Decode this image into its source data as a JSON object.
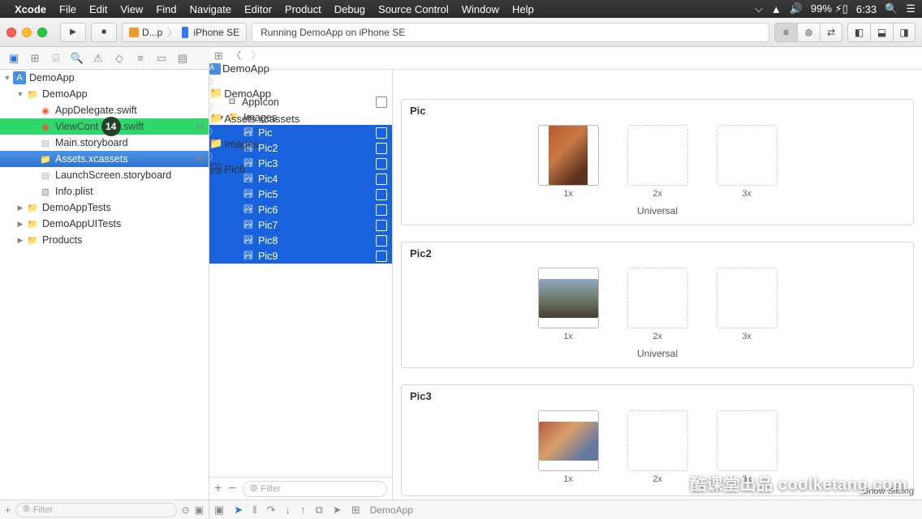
{
  "menubar": {
    "app": "Xcode",
    "items": [
      "File",
      "Edit",
      "View",
      "Find",
      "Navigate",
      "Editor",
      "Product",
      "Debug",
      "Source Control",
      "Window",
      "Help"
    ],
    "battery": "99%",
    "time": "6:33"
  },
  "toolbar": {
    "scheme_app": "D...p",
    "scheme_device": "iPhone SE",
    "status": "Running DemoApp on iPhone SE"
  },
  "breadcrumb": [
    "DemoApp",
    "DemoApp",
    "Assets.xcassets",
    "Images",
    "Pic6"
  ],
  "navigator": {
    "root": "DemoApp",
    "items": [
      {
        "label": "DemoApp",
        "type": "folder",
        "depth": 1,
        "disc": "▼"
      },
      {
        "label": "AppDelegate.swift",
        "type": "swift",
        "depth": 2
      },
      {
        "label": "ViewCont",
        "suffix": ".swift",
        "type": "swift",
        "depth": 2,
        "green": true,
        "circle": "14",
        "badge": "M"
      },
      {
        "label": "Main.storyboard",
        "type": "sboard",
        "depth": 2
      },
      {
        "label": "Assets.xcassets",
        "type": "assets",
        "depth": 2,
        "selected": true,
        "badge": "M"
      },
      {
        "label": "LaunchScreen.storyboard",
        "type": "sboard",
        "depth": 2
      },
      {
        "label": "Info.plist",
        "type": "plist",
        "depth": 2
      },
      {
        "label": "DemoAppTests",
        "type": "folder",
        "depth": 1,
        "disc": "▶"
      },
      {
        "label": "DemoAppUITests",
        "type": "folder",
        "depth": 1,
        "disc": "▶"
      },
      {
        "label": "Products",
        "type": "folder",
        "depth": 1,
        "disc": "▶"
      }
    ]
  },
  "assets": {
    "appicon": "AppIcon",
    "folder": "Images",
    "items": [
      "Pic",
      "Pic2",
      "Pic3",
      "Pic4",
      "Pic5",
      "Pic6",
      "Pic7",
      "Pic8",
      "Pic9"
    ],
    "filter_placeholder": "Filter"
  },
  "detail": {
    "cards": [
      {
        "title": "Pic",
        "labels": [
          "1x",
          "2x",
          "3x"
        ],
        "group": "Universal",
        "filled": 0,
        "thumb": "thumb"
      },
      {
        "title": "Pic2",
        "labels": [
          "1x",
          "2x",
          "3x"
        ],
        "group": "Universal",
        "filled": 0,
        "thumb": "thumb2"
      },
      {
        "title": "Pic3",
        "labels": [
          "1x",
          "2x",
          "3x"
        ],
        "group": "",
        "filled": 0,
        "thumb": "thumb3"
      }
    ],
    "slicing": "Show Slicing"
  },
  "bottom": {
    "filter_placeholder": "Filter",
    "target": "DemoApp"
  },
  "watermark": "酷课堂出品 coolketang.com"
}
